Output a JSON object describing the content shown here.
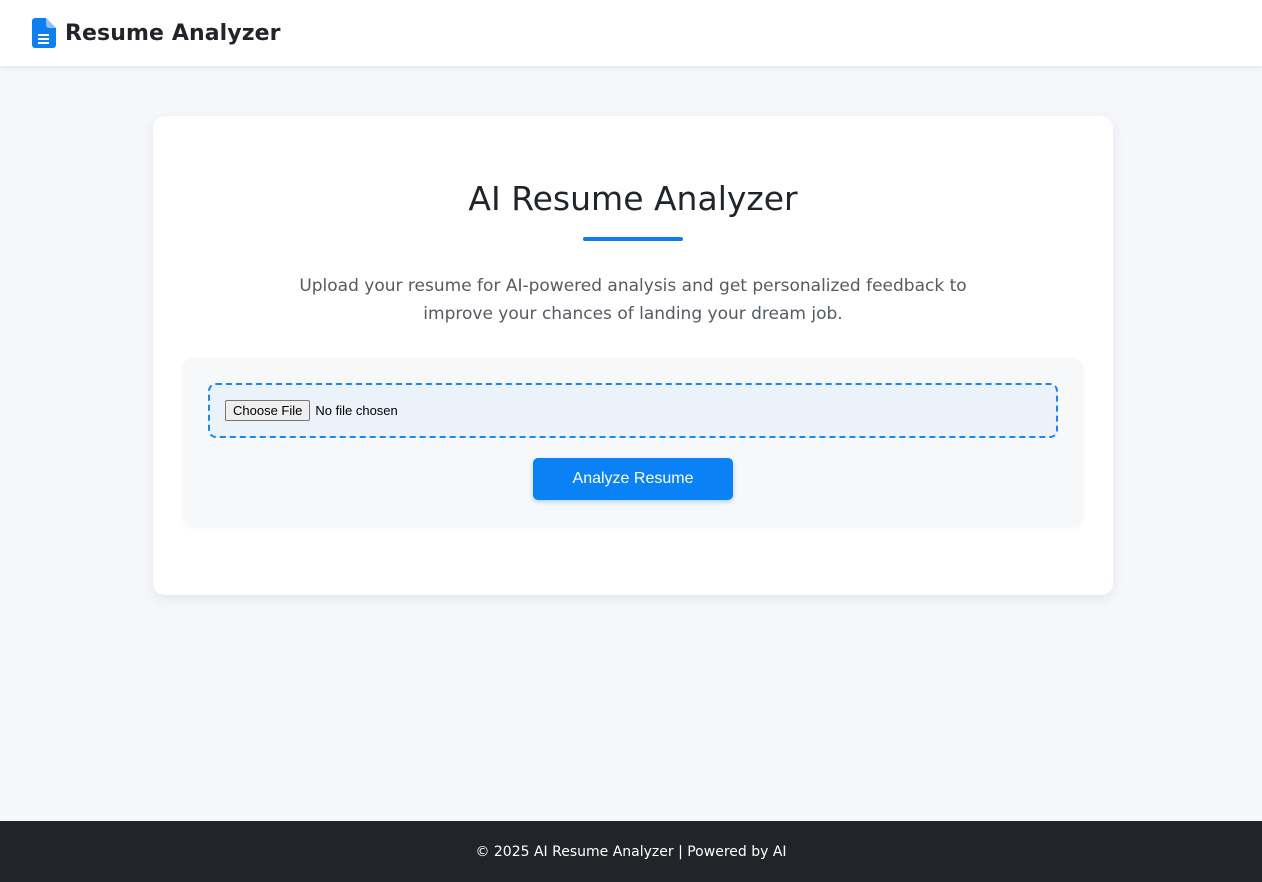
{
  "header": {
    "brand_icon": "file-text-icon",
    "brand_title": "Resume Analyzer",
    "accent_color": "#0d7ff0"
  },
  "main": {
    "title": "AI Resume Analyzer",
    "description": "Upload your resume for AI-powered analysis and get personalized feedback to improve your chances of landing your dream job.",
    "upload": {
      "choose_file_label": "Choose File",
      "file_status": "No file chosen"
    },
    "analyze_button_label": "Analyze Resume"
  },
  "footer": {
    "text": "© 2025 AI Resume Analyzer | Powered by AI",
    "background_color": "#212529"
  }
}
